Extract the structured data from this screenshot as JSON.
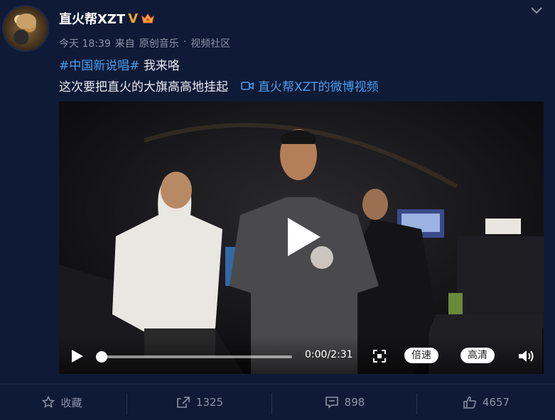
{
  "post": {
    "username": "直火帮XZT",
    "verified_badge": "V",
    "time": "今天 18:39",
    "source_prefix": "来自",
    "source": "原创音乐",
    "dot": "·",
    "community": "视频社区",
    "hashtag": "#中国新说唱#",
    "text1": " 我来咯",
    "text2": "这次要把直火的大旗高高地挂起",
    "video_link": "直火帮XZT的微博视频"
  },
  "video": {
    "time": "0:00/2:31",
    "speed_label": "倍速",
    "quality_label": "高清",
    "progress": 0.0
  },
  "footer": {
    "favorite_label": "收藏",
    "repost_count": "1325",
    "comment_count": "898",
    "like_count": "4657"
  },
  "colors": {
    "link": "#4a9df0",
    "background": "#0f1a36",
    "verified": "#f5a623"
  }
}
